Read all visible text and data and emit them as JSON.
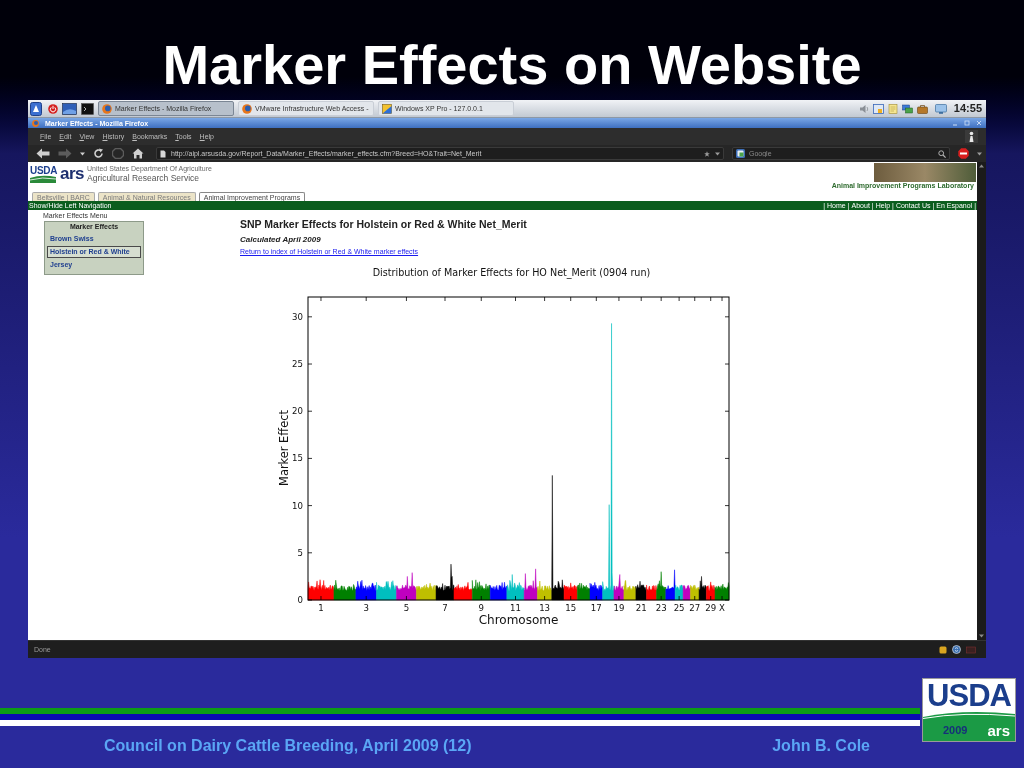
{
  "slide": {
    "title": "Marker Effects on Website",
    "footer": {
      "event": "Council on Dairy Cattle Breeding, April 2009 (12)",
      "author": "John B. Cole"
    },
    "logo": {
      "wordmark": "USDA",
      "year": "2009",
      "mark": "ars"
    }
  },
  "taskbar": {
    "tasks": [
      {
        "label": "Marker Effects - Mozilla Firefox",
        "kind": "browser",
        "selected": true
      },
      {
        "label": "VMware Infrastructure Web Access -",
        "kind": "browser",
        "selected": false
      },
      {
        "label": "Windows XP Pro - 127.0.0.1",
        "kind": "console",
        "selected": false
      }
    ],
    "clock": "14:55"
  },
  "window": {
    "title": "Marker Effects - Mozilla Firefox"
  },
  "menu": [
    "File",
    "Edit",
    "View",
    "History",
    "Bookmarks",
    "Tools",
    "Help"
  ],
  "toolbar": {
    "buttons": [
      {
        "kind": "back",
        "disabled": false
      },
      {
        "kind": "forward",
        "disabled": true
      },
      {
        "kind": "history",
        "disabled": false
      },
      {
        "kind": "reload",
        "disabled": false
      },
      {
        "kind": "stop",
        "disabled": true
      },
      {
        "kind": "home",
        "disabled": false
      }
    ],
    "url": "http://aipl.arsusda.gov/Report_Data/Marker_Effects/marker_effects.cfm?Breed=HO&Trait=Net_Merit",
    "search": {
      "placeholder": "Google"
    }
  },
  "page": {
    "header": {
      "usda": "USDA",
      "ars": "ars",
      "department": "United States Department Of Agriculture",
      "agency": "Agricultural Research Service",
      "lab": "Animal Improvement Programs Laboratory"
    },
    "tabs": [
      {
        "label": "Beltsville | BARC",
        "selected": false
      },
      {
        "label": "Animal & Natural Resources",
        "selected": false
      },
      {
        "label": "Animal Improvement Programs",
        "selected": true
      }
    ],
    "navbar": {
      "toggle": "Show/Hide Left Navigation",
      "separator": "|",
      "links": [
        "Home",
        "About",
        "Help",
        "Contact Us",
        "En Espanol"
      ]
    },
    "sidebar": {
      "caption": "Marker Effects Menu",
      "heading": "Marker Effects",
      "items": [
        {
          "label": "Brown Swiss",
          "selected": false
        },
        {
          "label": "Holstein or Red & White",
          "selected": true
        },
        {
          "label": "Jersey",
          "selected": false
        }
      ]
    },
    "heading": "SNP Marker Effects for Holstein or Red & White Net_Merit",
    "subheading": "Calculated April 2009",
    "link": "Return to index of Holstein or Red & White marker effects",
    "chart": {
      "title": "Distribution of Marker Effects for HO Net_Merit (0904 run)",
      "ylabel": "Marker Effect",
      "xlabel": "Chromosome",
      "yticks": [
        "30",
        "25",
        "20",
        "15",
        "10",
        "5",
        "0"
      ],
      "xticks": [
        "1",
        "3",
        "5",
        "7",
        "9",
        "11",
        "13",
        "15",
        "17",
        "19",
        "21",
        "23",
        "25",
        "27",
        "29",
        "X"
      ],
      "chromosomes": [
        {
          "color": "#ff0000"
        },
        {
          "color": "#008000"
        },
        {
          "color": "#0000ff"
        },
        {
          "color": "#00bfbf"
        },
        {
          "color": "#bf00bf"
        },
        {
          "color": "#bfbf00"
        },
        {
          "color": "#000000"
        },
        {
          "color": "#ff0000"
        },
        {
          "color": "#008000"
        },
        {
          "color": "#0000ff"
        },
        {
          "color": "#00bfbf"
        },
        {
          "color": "#bf00bf"
        },
        {
          "color": "#bfbf00"
        },
        {
          "color": "#000000"
        },
        {
          "color": "#ff0000"
        },
        {
          "color": "#008000"
        },
        {
          "color": "#0000ff"
        },
        {
          "color": "#00bfbf"
        },
        {
          "color": "#bf00bf"
        },
        {
          "color": "#bfbf00"
        },
        {
          "color": "#000000"
        },
        {
          "color": "#ff0000"
        },
        {
          "color": "#008000"
        },
        {
          "color": "#0000ff"
        },
        {
          "color": "#00bfbf"
        },
        {
          "color": "#bf00bf"
        },
        {
          "color": "#bfbf00"
        },
        {
          "color": "#000000"
        },
        {
          "color": "#ff0000"
        },
        {
          "color": "#008000"
        }
      ]
    }
  },
  "status_bar": {
    "text": "Done"
  }
}
